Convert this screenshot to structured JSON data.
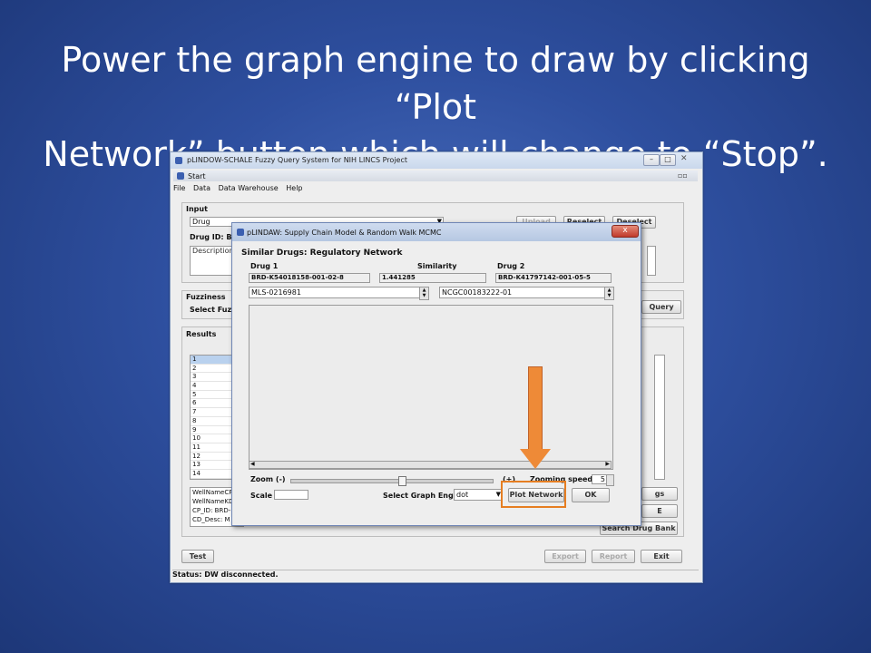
{
  "slide": {
    "title_line1": "Power the graph engine to draw by clicking “Plot",
    "title_line2": "Network” button which will change to “Stop”."
  },
  "main_window": {
    "title": "pLINDOW-SCHALE Fuzzy Query System for NIH LINCS Project",
    "inner_frame_title": "Start",
    "menu": [
      "File",
      "Data",
      "Data Warehouse",
      "Help"
    ],
    "input_panel": {
      "label": "Input",
      "drug_select_value": "Drug",
      "drug_id_label": "Drug ID: BRD",
      "description_label": "Description:",
      "upload_label": "Upload",
      "reselect_label": "Reselect",
      "deselect_label": "Deselect"
    },
    "fuzziness_panel": {
      "label": "Fuzziness",
      "select_label": "Select Fuzzin",
      "query_label": "Query"
    },
    "results_panel": {
      "label": "Results",
      "rows": [
        "1",
        "2",
        "3",
        "4",
        "5",
        "6",
        "7",
        "8",
        "9",
        "10",
        "11",
        "12",
        "13",
        "14"
      ],
      "detail_lines": [
        "WellNameCP",
        "WellNameKD",
        "CP_ID: BRD-",
        "CD_Desc: M"
      ],
      "right_btn1": "gs",
      "right_btn2": "E",
      "search_drug_bank_label": "Search Drug Bank"
    },
    "test_label": "Test",
    "export_label": "Export",
    "report_label": "Report",
    "exit_label": "Exit",
    "status": "Status: DW disconnected."
  },
  "dialog": {
    "title": "pLINDAW: Supply Chain Model & Random Walk MCMC",
    "close_label": "x",
    "heading": "Similar Drugs: Regulatory Network",
    "col_drug1": "Drug 1",
    "col_similarity": "Similarity",
    "col_drug2": "Drug 2",
    "drug1_id": "BRD-K54018158-001-02-8",
    "similarity_value": "1.441285",
    "drug2_id": "BRD-K41797142-001-05-5",
    "drug1_alt": "MLS-0216981",
    "drug2_alt": "NCGC00183222-01",
    "zoom_label": "Zoom (-)",
    "zoom_plus_label": "(+)",
    "zooming_speed_label": "Zooming speed",
    "zooming_speed_value": "5",
    "zoom_level": 0.55,
    "scale_label": "Scale",
    "graph_engine_label": "Select Graph Engine",
    "graph_engine_value": "dot",
    "plot_network_label": "Plot Network",
    "ok_label": "OK"
  },
  "colors": {
    "highlight": "#e67e22",
    "arrow": "#ee8a37",
    "slide_bg": "#2e4f9f"
  }
}
